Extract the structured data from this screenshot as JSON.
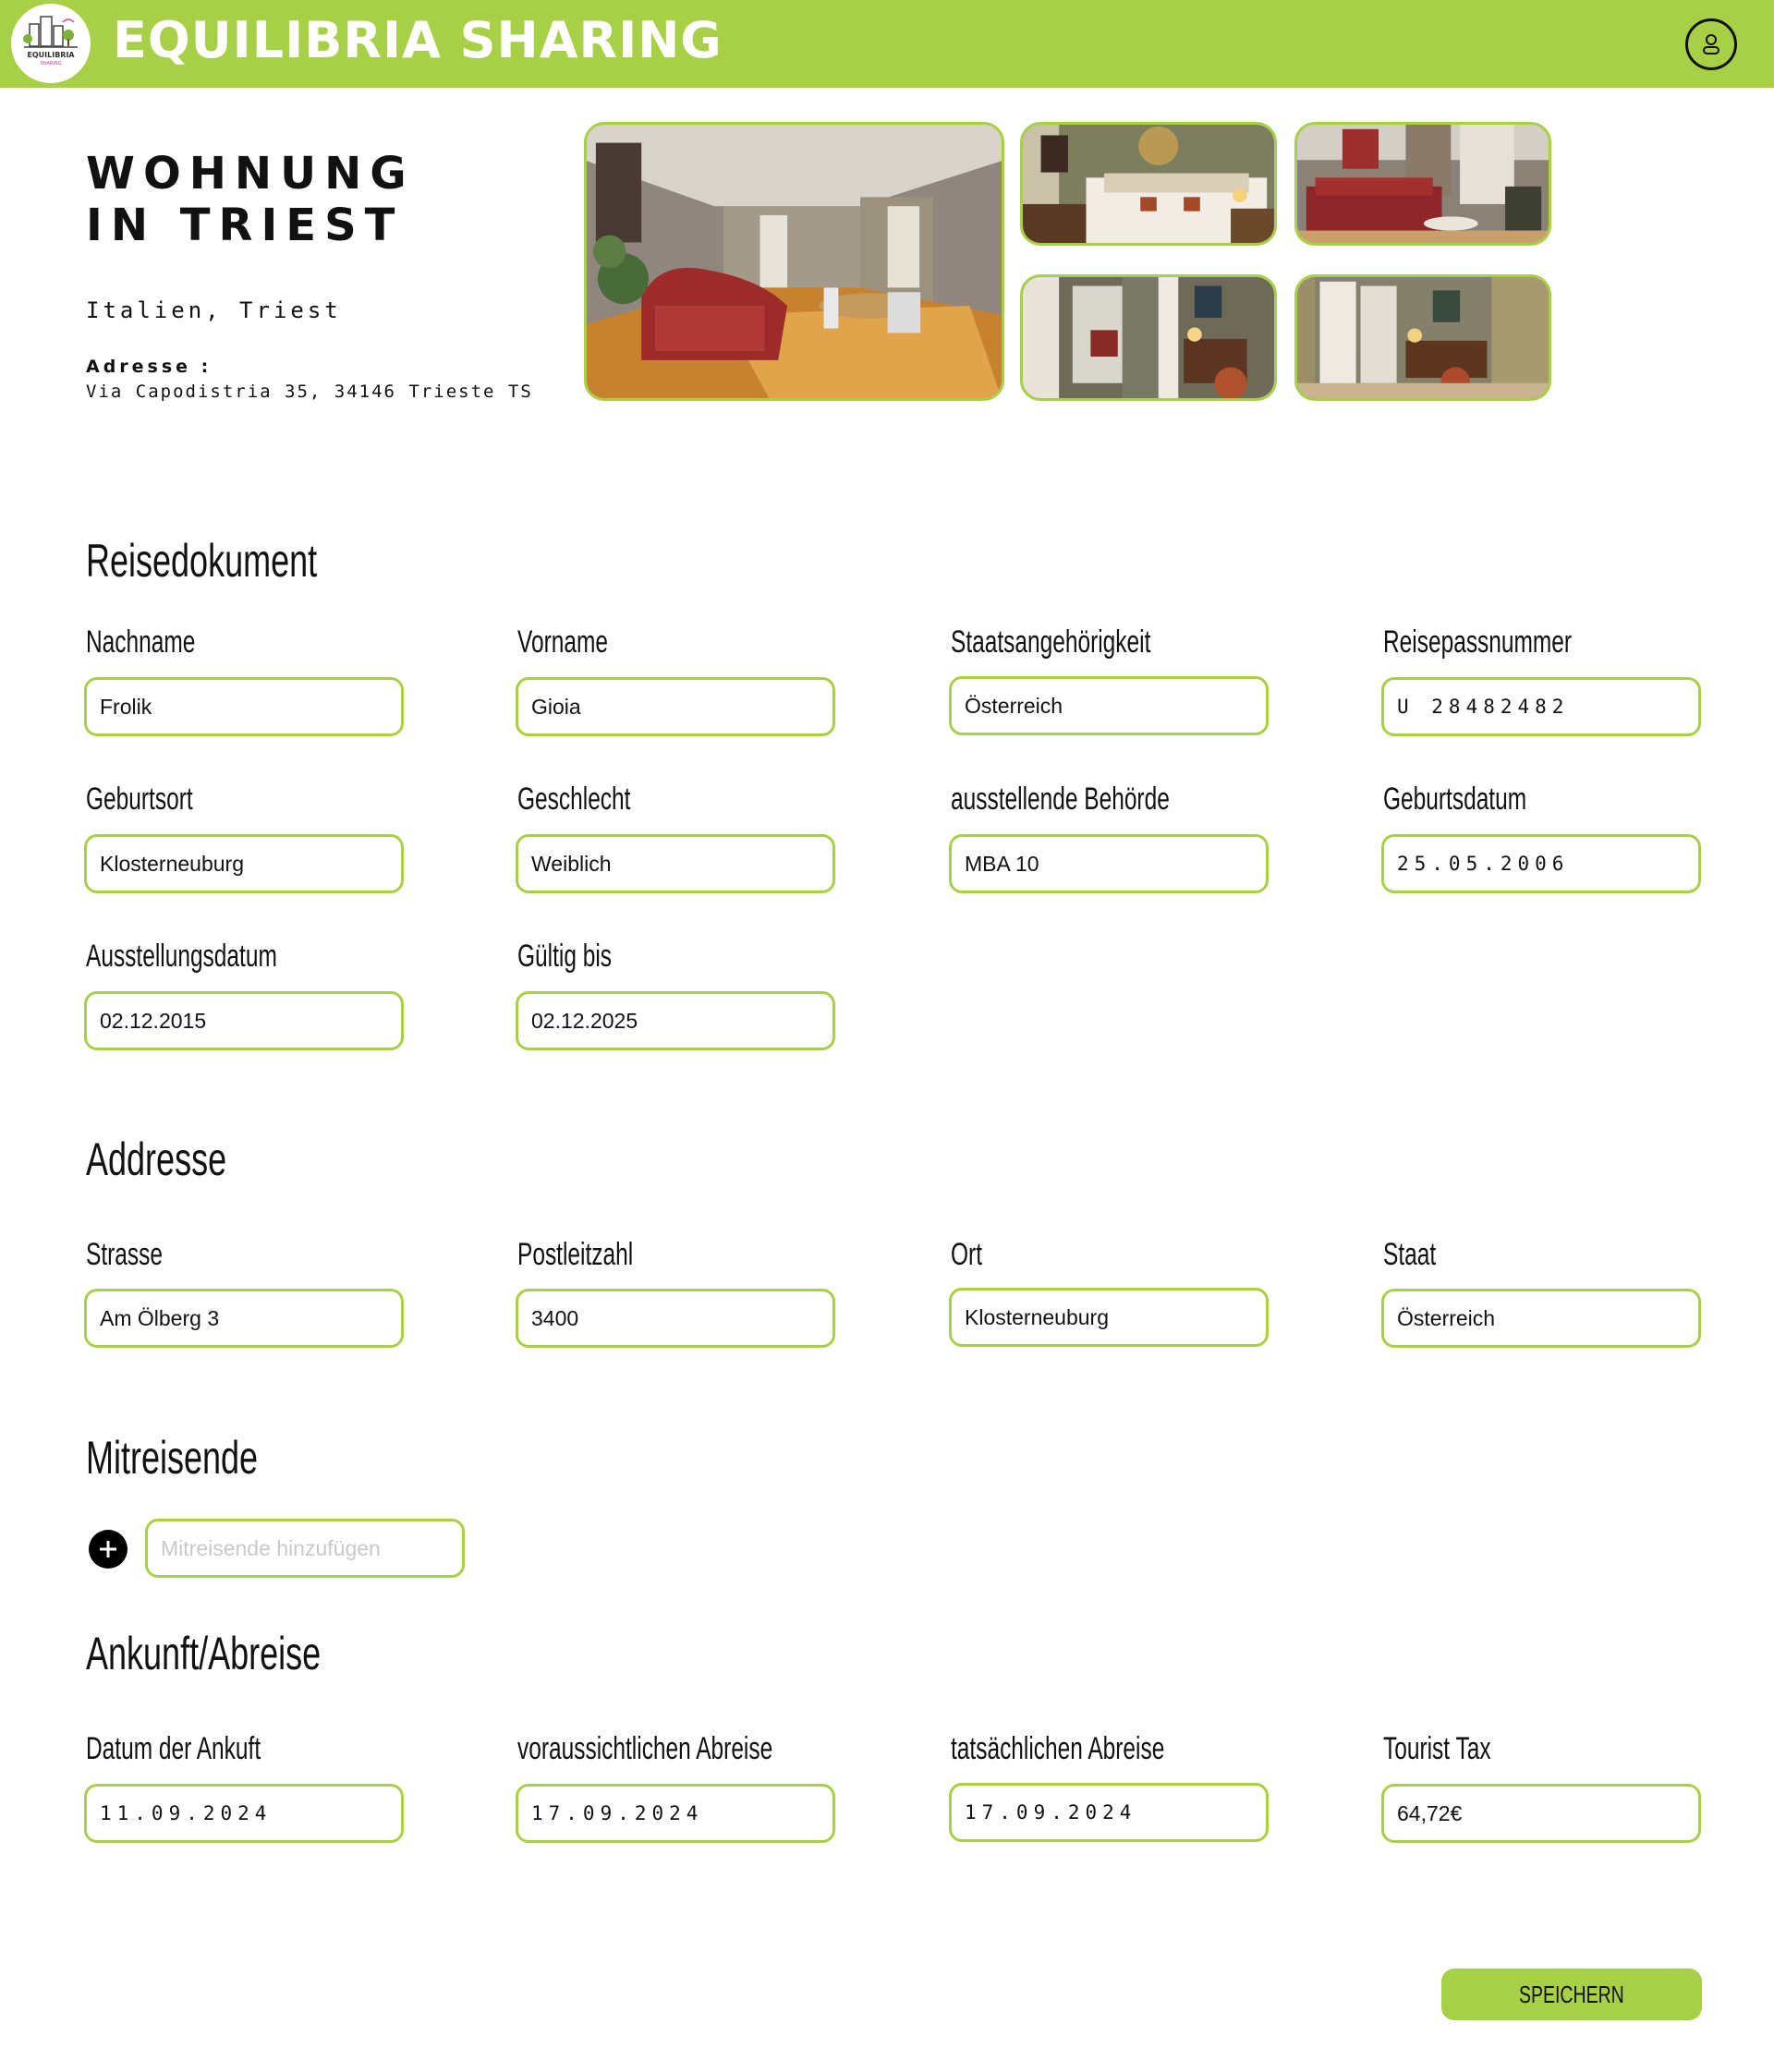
{
  "header": {
    "brand": "EQUILIBRIA SHARING",
    "logo_text_top": "EQUILIBRIA",
    "logo_text_bottom": "SHARING",
    "user_icon": "user-icon",
    "accent_color": "#a8d046"
  },
  "listing": {
    "title": "WOHNUNG IN TRIEST",
    "location": "Italien, Triest",
    "address_label": "Adresse :",
    "address": "Via Capodistria 35, 34146 Trieste TS"
  },
  "sections": {
    "travel_document": "Reisedokument",
    "address": "Addresse",
    "companions": "Mitreisende",
    "arrival_departure": "Ankunft/Abreise"
  },
  "travel_document": {
    "last_name": {
      "label": "Nachname",
      "value": "Frolik"
    },
    "first_name": {
      "label": "Vorname",
      "value": "Gioia"
    },
    "nationality": {
      "label": "Staatsangehörigkeit",
      "value": "Österreich"
    },
    "passport_number": {
      "label": "Reisepassnummer",
      "value": "U 28482482"
    },
    "birthplace": {
      "label": "Geburtsort",
      "value": "Klosterneuburg"
    },
    "gender": {
      "label": "Geschlecht",
      "value": "Weiblich"
    },
    "authority": {
      "label": "ausstellende Behörde",
      "value": "MBA 10"
    },
    "birth_date": {
      "label": "Geburtsdatum",
      "value": "25.05.2006"
    },
    "issue_date": {
      "label": "Ausstellungsdatum",
      "value": "02.12.2015"
    },
    "valid_until": {
      "label": "Gültig bis",
      "value": "02.12.2025"
    }
  },
  "address": {
    "street": {
      "label": "Strasse",
      "value": "Am Ölberg 3"
    },
    "postal_code": {
      "label": "Postleitzahl",
      "value": "3400"
    },
    "city": {
      "label": "Ort",
      "value": "Klosterneuburg"
    },
    "country": {
      "label": "Staat",
      "value": "Österreich"
    }
  },
  "companions": {
    "add_icon": "plus-icon",
    "placeholder": "Mitreisende hinzufügen"
  },
  "arrival_departure": {
    "arrival": {
      "label": "Datum der Ankuft",
      "value": "11.09.2024"
    },
    "expected_departure": {
      "label": "voraussichtlichen Abreise",
      "value": "17.09.2024"
    },
    "actual_departure": {
      "label": "tatsächlichen Abreise",
      "value": "17.09.2024"
    },
    "tourist_tax": {
      "label": "Tourist Tax",
      "value": "64,72€"
    }
  },
  "actions": {
    "save": "SPEICHERN"
  }
}
